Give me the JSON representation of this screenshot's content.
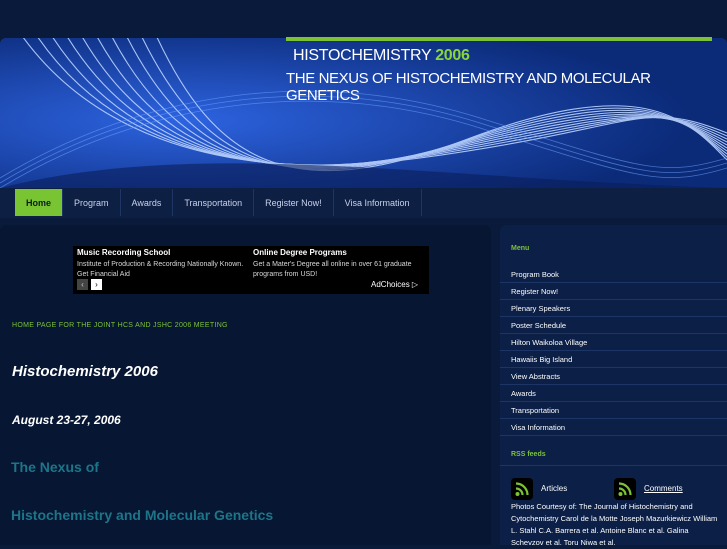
{
  "site": {
    "title_main": "HISTOCHEMISTRY ",
    "title_year": "2006",
    "subtitle": "THE NEXUS OF HISTOCHEMISTRY AND MOLECULAR GENETICS"
  },
  "nav": {
    "items": [
      {
        "label": "Home",
        "active": true
      },
      {
        "label": "Program"
      },
      {
        "label": "Awards"
      },
      {
        "label": "Transportation"
      },
      {
        "label": "Register Now!"
      },
      {
        "label": "Visa Information"
      }
    ]
  },
  "ad": {
    "ads": [
      {
        "title": "Music Recording School",
        "text": "Institute of Production & Recording Nationally Known. Get Financial Aid"
      },
      {
        "title": "Online Degree Programs",
        "text": "Get a Mater's Degree all online in over 61 graduate programs from USD!"
      }
    ],
    "prev": "‹",
    "next": "›",
    "adchoices": "AdChoices ▷"
  },
  "main": {
    "tagline": "HOME PAGE FOR THE JOINT HCS AND JSHC 2006 MEETING",
    "heading1": "Histochemistry 2006",
    "heading2": "August 23-27, 2006",
    "heading3": "The Nexus of",
    "heading4": "Histochemistry and Molecular Genetics"
  },
  "sidebar": {
    "menu_title": "Menu",
    "menu": [
      "Program Book",
      "Register Now!",
      "Plenary Speakers",
      "Poster Schedule",
      "Hilton Waikoloa Village",
      "Hawaiis Big Island",
      "View Abstracts",
      "Awards",
      "Transportation",
      "Visa Information"
    ],
    "rss_title": "RSS feeds",
    "rss": [
      {
        "label": "Articles",
        "icon": "rss-icon"
      },
      {
        "label": "Comments",
        "icon": "rss-icon"
      }
    ],
    "photo_credit": "Photos Courtesy of: The Journal of Histochemistry and Cytochemistry Carol de la Motte Joseph Mazurkiewicz William L. Stahl C.A. Barrera et al. Antoine Blanc et al. Galina Schevzov et al. Toru Niwa et al."
  },
  "colors": {
    "accent": "#7dc234",
    "background": "#0a1a3a",
    "header": "#0b2a78",
    "teal": "#1d7688"
  }
}
